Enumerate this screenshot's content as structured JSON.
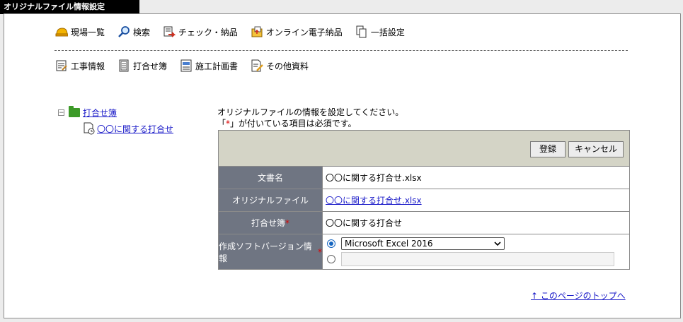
{
  "window": {
    "title": "オリジナルファイル情報設定"
  },
  "nav_top": [
    {
      "label": "現場一覧",
      "icon": "helmet-icon"
    },
    {
      "label": "検索",
      "icon": "magnifier-icon"
    },
    {
      "label": "チェック・納品",
      "icon": "check-deliver-icon"
    },
    {
      "label": "オンライン電子納品",
      "icon": "online-deliver-icon"
    },
    {
      "label": "一括設定",
      "icon": "copy-docs-icon"
    }
  ],
  "nav_bottom": [
    {
      "label": "工事情報",
      "icon": "construction-info-icon"
    },
    {
      "label": "打合せ簿",
      "icon": "meeting-book-icon"
    },
    {
      "label": "施工計画書",
      "icon": "plan-doc-icon"
    },
    {
      "label": "その他資料",
      "icon": "other-docs-icon"
    }
  ],
  "tree": {
    "toggle": "−",
    "root": "打合せ簿",
    "child": "〇〇に関する打合せ"
  },
  "message": {
    "line1": "オリジナルファイルの情報を設定してください。",
    "line2_pre": "「",
    "line2_mark": "*",
    "line2_post": "」が付いている項目は必須です。"
  },
  "buttons": {
    "register": "登録",
    "cancel": "キャンセル"
  },
  "form": {
    "doc_name_label": "文書名",
    "doc_name_value": "〇〇に関する打合せ.xlsx",
    "original_file_label": "オリジナルファイル",
    "original_file_value": "〇〇に関する打合せ.xlsx",
    "meeting_label": "打合せ簿",
    "meeting_value": "〇〇に関する打合せ",
    "software_label": "作成ソフトバージョン情報",
    "software_selected": "Microsoft Excel 2016",
    "required_mark": "*"
  },
  "page_top_link": "↑ このページのトップへ"
}
